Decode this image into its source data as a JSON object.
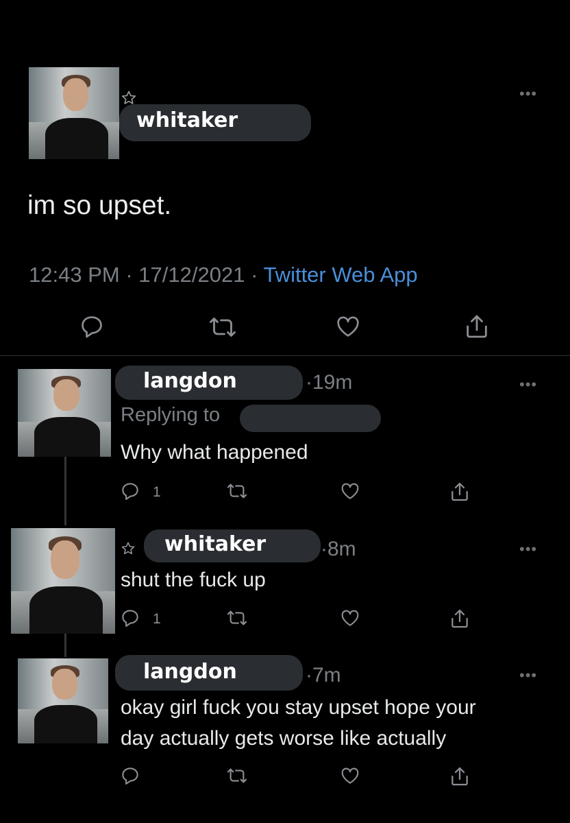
{
  "main_tweet": {
    "username": "whitaker",
    "text": "im so upset.",
    "time": "12:43 PM",
    "separator": "·",
    "date": "17/12/2021",
    "source": "Twitter Web App"
  },
  "replies": [
    {
      "username": "langdon",
      "time": "19m",
      "replying_to_label": "Replying to",
      "text": "Why what happened",
      "reply_count": "1"
    },
    {
      "username": "whitaker",
      "time": "8m",
      "text": "shut the fuck up",
      "reply_count": "1"
    },
    {
      "username": "langdon",
      "time": "7m",
      "text_line1": "okay girl fuck you stay upset hope your",
      "text_line2": "day actually gets worse like actually"
    }
  ],
  "icons": {
    "reply": "reply-icon",
    "retweet": "retweet-icon",
    "like": "heart-icon",
    "share": "share-icon",
    "more": "more-icon",
    "star": "star-icon"
  },
  "colors": {
    "background": "#000000",
    "pill": "#2a2d31",
    "link": "#4a8fd9",
    "muted": "#7b8085"
  }
}
